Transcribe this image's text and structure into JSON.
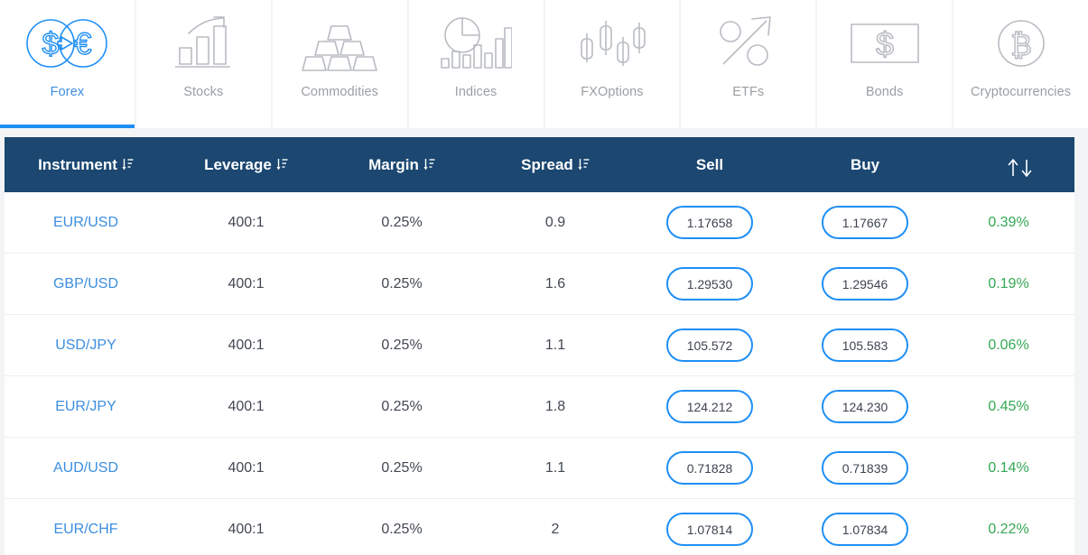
{
  "tabs": [
    {
      "label": "Forex",
      "icon": "forex-exchange-icon",
      "active": true
    },
    {
      "label": "Stocks",
      "icon": "bar-chart-arrow-icon",
      "active": false
    },
    {
      "label": "Commodities",
      "icon": "gold-bars-icon",
      "active": false
    },
    {
      "label": "Indices",
      "icon": "pie-bar-chart-icon",
      "active": false
    },
    {
      "label": "FXOptions",
      "icon": "candlestick-icon",
      "active": false
    },
    {
      "label": "ETFs",
      "icon": "percent-arrow-icon",
      "active": false
    },
    {
      "label": "Bonds",
      "icon": "dollar-banknote-icon",
      "active": false
    },
    {
      "label": "Cryptocurrencies",
      "icon": "bitcoin-coin-icon",
      "active": false
    }
  ],
  "table": {
    "columns": [
      {
        "label": "Instrument",
        "sortable": true,
        "sort_icon": "sort-descending-icon"
      },
      {
        "label": "Leverage",
        "sortable": true,
        "sort_icon": "sort-descending-icon"
      },
      {
        "label": "Margin",
        "sortable": true,
        "sort_icon": "sort-descending-icon"
      },
      {
        "label": "Spread",
        "sortable": true,
        "sort_icon": "sort-descending-icon"
      },
      {
        "label": "Sell",
        "sortable": false,
        "sort_icon": ""
      },
      {
        "label": "Buy",
        "sortable": false,
        "sort_icon": ""
      },
      {
        "label": "",
        "sortable": true,
        "sort_icon": "up-down-arrows-icon"
      }
    ],
    "rows": [
      {
        "instrument": "EUR/USD",
        "leverage": "400:1",
        "margin": "0.25%",
        "spread": "0.9",
        "sell": "1.17658",
        "buy": "1.17667",
        "change": "0.39%"
      },
      {
        "instrument": "GBP/USD",
        "leverage": "400:1",
        "margin": "0.25%",
        "spread": "1.6",
        "sell": "1.29530",
        "buy": "1.29546",
        "change": "0.19%"
      },
      {
        "instrument": "USD/JPY",
        "leverage": "400:1",
        "margin": "0.25%",
        "spread": "1.1",
        "sell": "105.572",
        "buy": "105.583",
        "change": "0.06%"
      },
      {
        "instrument": "EUR/JPY",
        "leverage": "400:1",
        "margin": "0.25%",
        "spread": "1.8",
        "sell": "124.212",
        "buy": "124.230",
        "change": "0.45%"
      },
      {
        "instrument": "AUD/USD",
        "leverage": "400:1",
        "margin": "0.25%",
        "spread": "1.1",
        "sell": "0.71828",
        "buy": "0.71839",
        "change": "0.14%"
      },
      {
        "instrument": "EUR/CHF",
        "leverage": "400:1",
        "margin": "0.25%",
        "spread": "2",
        "sell": "1.07814",
        "buy": "1.07834",
        "change": "0.22%"
      }
    ]
  },
  "colors": {
    "header_bg": "#1b4771",
    "accent_blue": "#1f8ff5",
    "link_blue": "#3c8ee0",
    "change_green": "#34a853",
    "icon_gray": "#b8bcc2",
    "page_bg": "#f2f4f5"
  }
}
